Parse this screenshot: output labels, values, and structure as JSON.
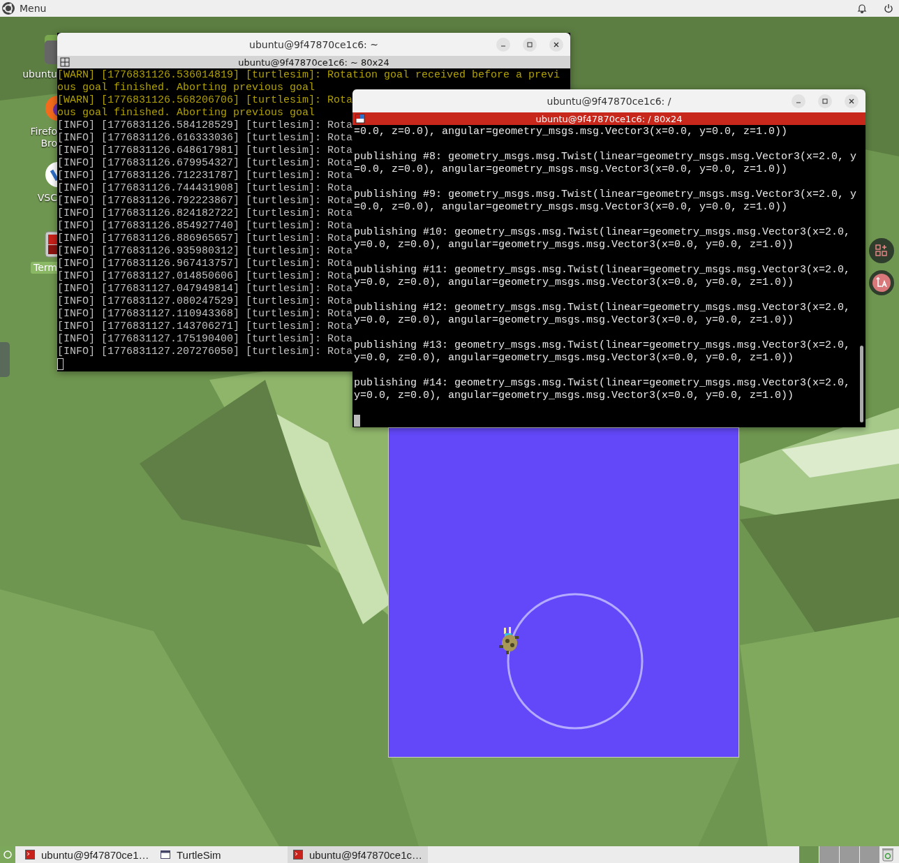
{
  "top_panel": {
    "menu_label": "Menu"
  },
  "desktop_icons": [
    {
      "kind": "folder",
      "label_lines": [
        "ubuntu"
      ],
      "selected": false
    },
    {
      "kind": "browser",
      "label_lines": [
        "Firefo",
        "Bro"
      ],
      "selected": false
    },
    {
      "kind": "editor",
      "label_lines": [
        "VSC"
      ],
      "selected": false
    },
    {
      "kind": "terminal",
      "label_lines": [
        "Term"
      ],
      "selected": true
    }
  ],
  "terminal_back": {
    "title": "ubuntu@9f47870ce1c6: ~",
    "tab_label": "ubuntu@9f47870ce1c6: ~ 80x24",
    "tab_active": false,
    "lines": [
      {
        "kind": "warn",
        "text": "[WARN] [1776831126.536014819] [turtlesim]: Rotation goal received before a previ"
      },
      {
        "kind": "warn",
        "text": "ous goal finished. Aborting previous goal"
      },
      {
        "kind": "warn",
        "text": "[WARN] [1776831126.568206706] [turtlesim]: Rota"
      },
      {
        "kind": "warn",
        "text": "ous goal finished. Aborting previous goal"
      },
      {
        "kind": "info",
        "text": "[INFO] [1776831126.584128529] [turtlesim]: Rota"
      },
      {
        "kind": "info",
        "text": "[INFO] [1776831126.616333036] [turtlesim]: Rota"
      },
      {
        "kind": "info",
        "text": "[INFO] [1776831126.648617981] [turtlesim]: Rota"
      },
      {
        "kind": "info",
        "text": "[INFO] [1776831126.679954327] [turtlesim]: Rota"
      },
      {
        "kind": "info",
        "text": "[INFO] [1776831126.712231787] [turtlesim]: Rota"
      },
      {
        "kind": "info",
        "text": "[INFO] [1776831126.744431908] [turtlesim]: Rota"
      },
      {
        "kind": "info",
        "text": "[INFO] [1776831126.792223867] [turtlesim]: Rota"
      },
      {
        "kind": "info",
        "text": "[INFO] [1776831126.824182722] [turtlesim]: Rota"
      },
      {
        "kind": "info",
        "text": "[INFO] [1776831126.854927740] [turtlesim]: Rota"
      },
      {
        "kind": "info",
        "text": "[INFO] [1776831126.886965657] [turtlesim]: Rota"
      },
      {
        "kind": "info",
        "text": "[INFO] [1776831126.935980312] [turtlesim]: Rota"
      },
      {
        "kind": "info",
        "text": "[INFO] [1776831126.967413757] [turtlesim]: Rota"
      },
      {
        "kind": "info",
        "text": "[INFO] [1776831127.014850606] [turtlesim]: Rota"
      },
      {
        "kind": "info",
        "text": "[INFO] [1776831127.047949814] [turtlesim]: Rota"
      },
      {
        "kind": "info",
        "text": "[INFO] [1776831127.080247529] [turtlesim]: Rota"
      },
      {
        "kind": "info",
        "text": "[INFO] [1776831127.110943368] [turtlesim]: Rota"
      },
      {
        "kind": "info",
        "text": "[INFO] [1776831127.143706271] [turtlesim]: Rota"
      },
      {
        "kind": "info",
        "text": "[INFO] [1776831127.175190400] [turtlesim]: Rota"
      },
      {
        "kind": "info",
        "text": "[INFO] [1776831127.207276050] [turtlesim]: Rota"
      }
    ]
  },
  "terminal_front": {
    "title": "ubuntu@9f47870ce1c6: /",
    "tab_label": "ubuntu@9f47870ce1c6: / 80x24",
    "tab_active": true,
    "blocks": [
      {
        "lines": [
          "=0.0, z=0.0), angular=geometry_msgs.msg.Vector3(x=0.0, y=0.0, z=1.0))"
        ]
      },
      {
        "lines": [
          "publishing #8: geometry_msgs.msg.Twist(linear=geometry_msgs.msg.Vector3(x=2.0, y",
          "=0.0, z=0.0), angular=geometry_msgs.msg.Vector3(x=0.0, y=0.0, z=1.0))"
        ]
      },
      {
        "lines": [
          "publishing #9: geometry_msgs.msg.Twist(linear=geometry_msgs.msg.Vector3(x=2.0, y",
          "=0.0, z=0.0), angular=geometry_msgs.msg.Vector3(x=0.0, y=0.0, z=1.0))"
        ]
      },
      {
        "lines": [
          "publishing #10: geometry_msgs.msg.Twist(linear=geometry_msgs.msg.Vector3(x=2.0,",
          "y=0.0, z=0.0), angular=geometry_msgs.msg.Vector3(x=0.0, y=0.0, z=1.0))"
        ]
      },
      {
        "lines": [
          "publishing #11: geometry_msgs.msg.Twist(linear=geometry_msgs.msg.Vector3(x=2.0,",
          "y=0.0, z=0.0), angular=geometry_msgs.msg.Vector3(x=0.0, y=0.0, z=1.0))"
        ]
      },
      {
        "lines": [
          "publishing #12: geometry_msgs.msg.Twist(linear=geometry_msgs.msg.Vector3(x=2.0,",
          "y=0.0, z=0.0), angular=geometry_msgs.msg.Vector3(x=0.0, y=0.0, z=1.0))"
        ]
      },
      {
        "lines": [
          "publishing #13: geometry_msgs.msg.Twist(linear=geometry_msgs.msg.Vector3(x=2.0,",
          "y=0.0, z=0.0), angular=geometry_msgs.msg.Vector3(x=0.0, y=0.0, z=1.0))"
        ]
      },
      {
        "lines": [
          "publishing #14: geometry_msgs.msg.Twist(linear=geometry_msgs.msg.Vector3(x=2.0,",
          "y=0.0, z=0.0), angular=geometry_msgs.msg.Vector3(x=0.0, y=0.0, z=1.0))"
        ]
      }
    ]
  },
  "taskbar": {
    "items": [
      {
        "kind": "terminal",
        "label": "ubuntu@9f47870ce1…",
        "selected": false
      },
      {
        "kind": "window",
        "label": "TurtleSim",
        "selected": false
      },
      {
        "kind": "terminal",
        "label": "ubuntu@9f47870ce1c…",
        "selected": true
      }
    ],
    "workspaces": [
      {
        "selected": true
      },
      {
        "selected": false
      },
      {
        "selected": false
      },
      {
        "selected": false
      }
    ]
  }
}
